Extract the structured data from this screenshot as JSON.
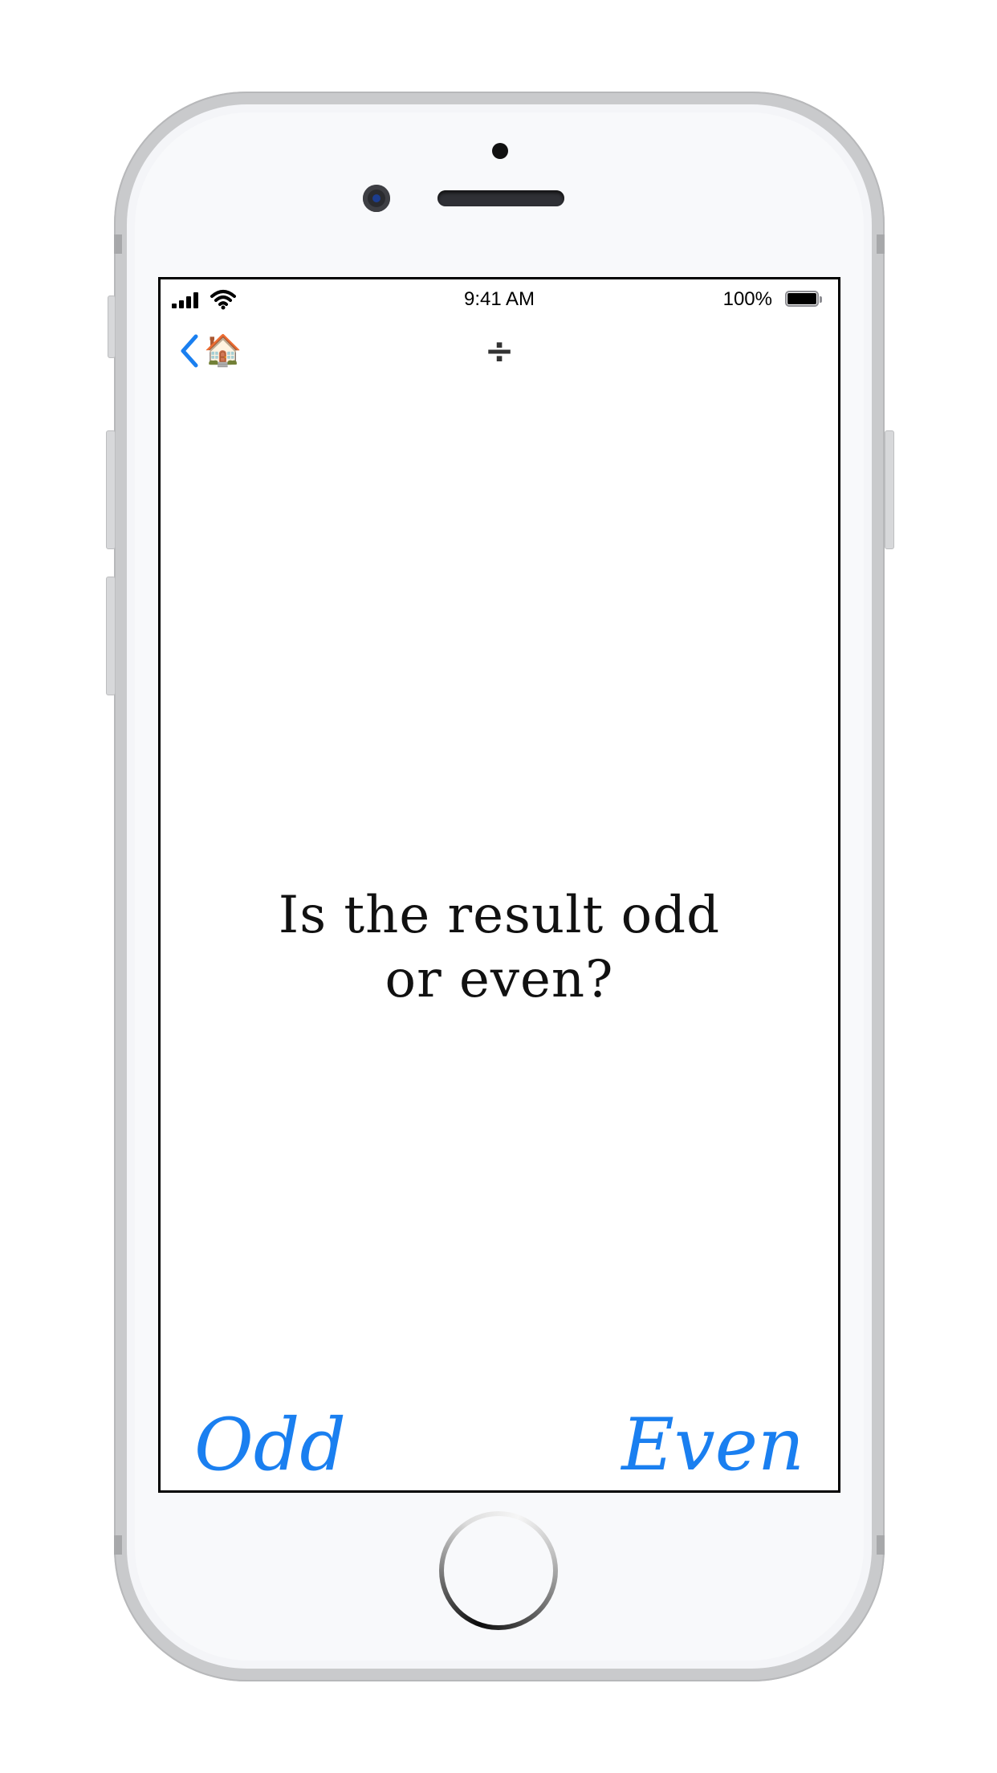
{
  "status_bar": {
    "time": "9:41 AM",
    "battery_percent_label": "100%",
    "battery_level": 1.0,
    "signal_bars": 4
  },
  "nav": {
    "back_label": "🏠",
    "title": "÷"
  },
  "question": {
    "line1": "Is the result odd",
    "line2": "or even?"
  },
  "answers": {
    "odd_label": "Odd",
    "even_label": "Even"
  },
  "colors": {
    "accent": "#1A7FF0",
    "text": "#111111",
    "nav_title": "#333333",
    "device_body": "#C9CACC"
  },
  "icons": {
    "back": "chevron-left-icon",
    "home": "house-emoji",
    "wifi": "wifi-icon",
    "signal": "cellular-signal-icon",
    "battery": "battery-icon"
  }
}
